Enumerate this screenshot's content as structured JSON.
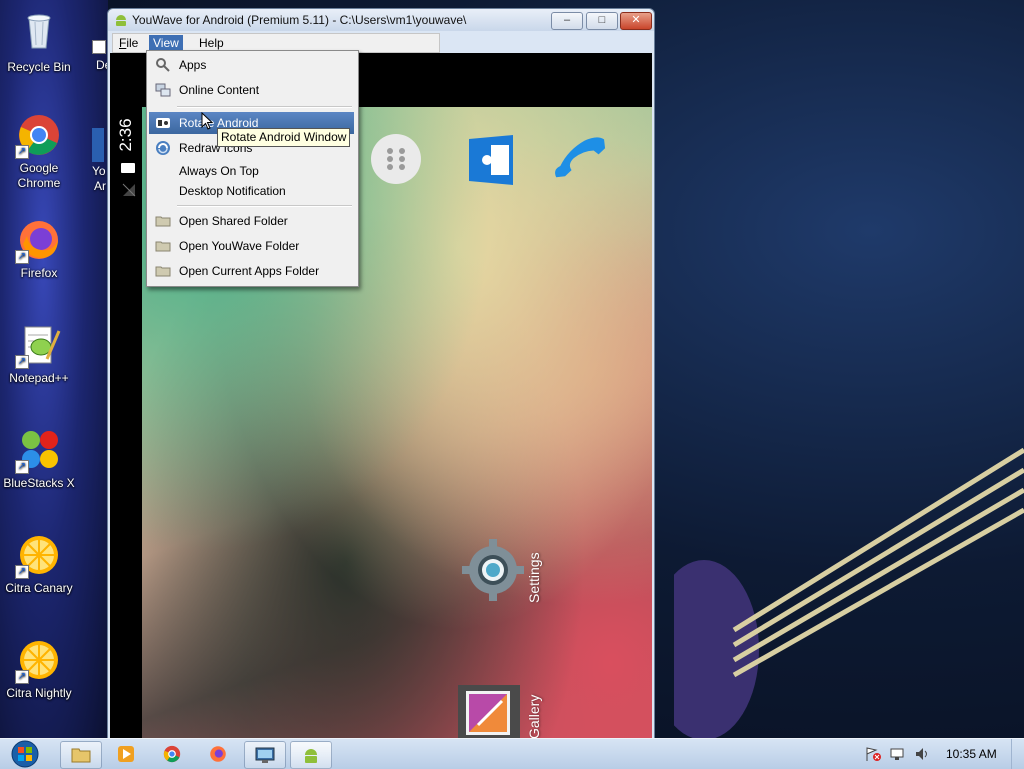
{
  "desktop": {
    "icons": [
      {
        "label": "Recycle Bin",
        "icon": "recycle-bin-icon"
      },
      {
        "label": "Google Chrome",
        "icon": "chrome-icon"
      },
      {
        "label": "Firefox",
        "icon": "firefox-icon"
      },
      {
        "label": "Notepad++",
        "icon": "notepad-plus-plus-icon"
      },
      {
        "label": "BlueStacks X",
        "icon": "bluestacks-icon"
      },
      {
        "label": "Citra Canary",
        "icon": "citra-canary-icon"
      },
      {
        "label": "Citra Nightly",
        "icon": "citra-nightly-icon"
      }
    ],
    "partial_labels": [
      "De",
      "Yo",
      "Ar"
    ]
  },
  "window": {
    "title": "YouWave for Android (Premium 5.11) - C:\\Users\\vm1\\youwave\\",
    "controls": {
      "minimize": "–",
      "maximize": "□",
      "close": "✕"
    },
    "menubar": {
      "file": {
        "label_rest": "ile",
        "accel": "F"
      },
      "view": {
        "label": "View"
      },
      "help": {
        "label": "Help"
      }
    }
  },
  "android": {
    "clock": "2:36",
    "home_apps": [
      {
        "label": "Settings",
        "icon": "settings-gear-icon"
      },
      {
        "label": "Gallery",
        "icon": "gallery-icon"
      }
    ],
    "dock_icons": [
      "app-drawer-icon",
      "contacts-icon",
      "phone-icon"
    ]
  },
  "view_menu": {
    "items": [
      {
        "label": "Apps",
        "icon": "magnifier-icon"
      },
      {
        "label": "Online Content",
        "icon": "online-content-icon"
      },
      {
        "label": "Rotate Android",
        "icon": "rotate-icon",
        "highlighted": true
      },
      {
        "label": "Redraw Icons",
        "icon": "redraw-icon"
      },
      {
        "label": "Always On Top",
        "icon": ""
      },
      {
        "label": "Desktop Notification",
        "icon": ""
      },
      {
        "label": "Open Shared Folder",
        "icon": "folder-icon"
      },
      {
        "label": "Open YouWave Folder",
        "icon": "folder-icon"
      },
      {
        "label": "Open Current Apps Folder",
        "icon": "folder-icon"
      }
    ],
    "tooltip": "Rotate Android Window"
  },
  "taskbar": {
    "apps": [
      {
        "name": "explorer",
        "icon": "file-explorer-icon"
      },
      {
        "name": "media-player",
        "icon": "media-player-icon"
      },
      {
        "name": "chrome",
        "icon": "chrome-icon"
      },
      {
        "name": "firefox",
        "icon": "firefox-icon"
      },
      {
        "name": "remote",
        "icon": "remote-desktop-icon"
      },
      {
        "name": "youwave",
        "icon": "android-icon"
      }
    ],
    "time": "10:35 AM"
  },
  "colors": {
    "menu_highlight": "#3e6fb4",
    "tooltip_bg": "#ffffe1",
    "taskbar": "#c9d9ee"
  }
}
